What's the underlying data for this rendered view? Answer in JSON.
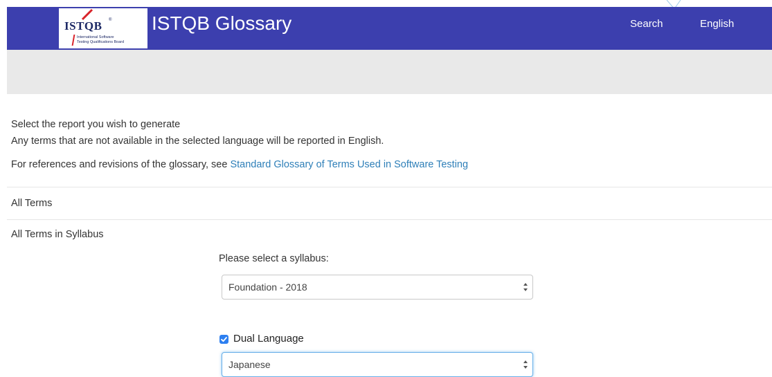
{
  "header": {
    "logo_brand": "ISTQB",
    "logo_tm": "®",
    "logo_sub1": "International Software",
    "logo_sub2": "Testing Qualifications Board",
    "title": "ISTQB Glossary",
    "nav_search": "Search",
    "nav_language": "English",
    "nav_bg_color": "#3c3fae"
  },
  "main": {
    "heading": "Select the report you wish to generate",
    "info": "Any terms that are not available in the selected language will be reported in English.",
    "ref_prefix": "For references and revisions of the glossary, see ",
    "ref_link": "Standard Glossary of Terms Used in Software Testing",
    "ref_link_color": "#2e7fb8"
  },
  "reports": {
    "all_terms": "All Terms",
    "all_terms_syllabus": "All Terms in Syllabus",
    "syllabus_label": "Please select a syllabus:",
    "syllabus_selected": "Foundation - 2018",
    "dual_language_label": "Dual Language",
    "dual_language_checked": true,
    "language_selected": "Japanese"
  },
  "icons": {
    "logo": "istqb-logo",
    "select_arrows": "updown-arrows-icon",
    "checkbox": "checkmark-icon"
  }
}
